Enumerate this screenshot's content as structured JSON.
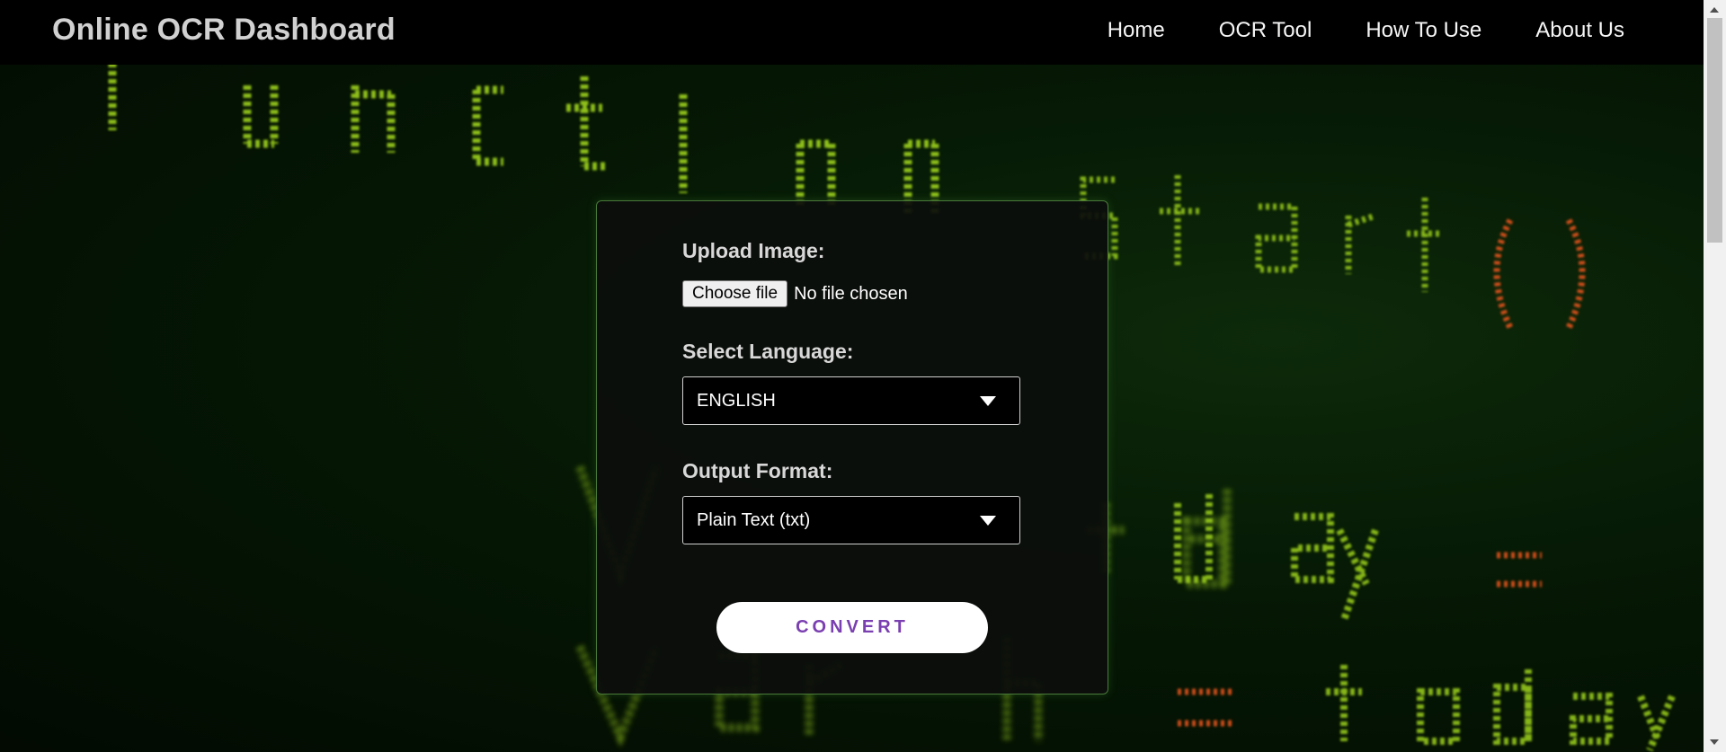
{
  "header": {
    "title": "Online OCR Dashboard",
    "nav": [
      "Home",
      "OCR Tool",
      "How To Use",
      "About Us"
    ]
  },
  "background": {
    "lines": [
      "function start()",
      "var today =",
      "var h = today"
    ],
    "code_color": "#9ed21a",
    "accent_color": "#e8541c"
  },
  "form": {
    "upload_label": "Upload Image:",
    "file_button": "Choose file",
    "file_status": "No file chosen",
    "language_label": "Select Language:",
    "language_value": "ENGLISH",
    "format_label": "Output Format:",
    "format_value": "Plain Text (txt)",
    "convert_label": "CONVERT"
  },
  "colors": {
    "navbar": "#000000",
    "button_text": "#7a3fb0",
    "card_border": "#4a7a3a"
  }
}
